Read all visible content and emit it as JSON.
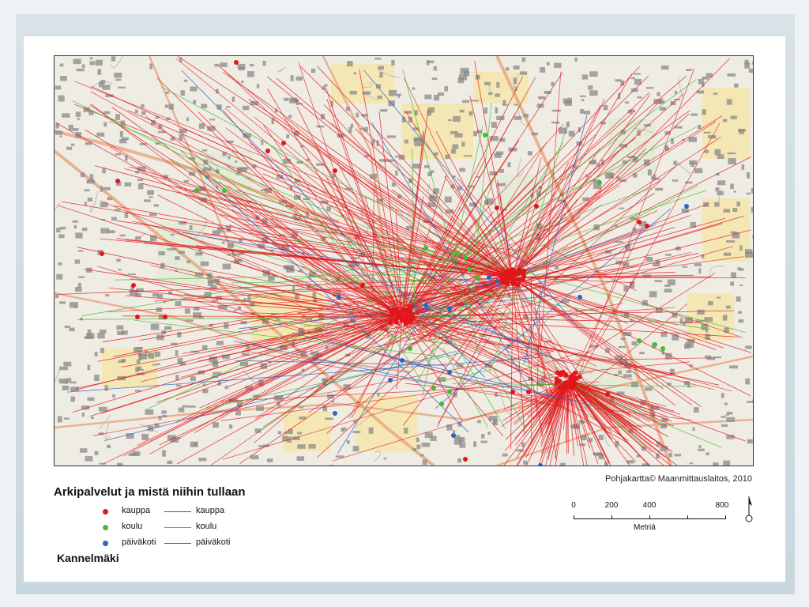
{
  "map": {
    "title": "Arkipalvelut ja mistä niihin tullaan",
    "place": "Kannelmäki",
    "credit": "Pohjakartta© Maanmittauslaitos, 2010",
    "colors": {
      "kauppa": "#e0161b",
      "koulu": "#3fbf2e",
      "paivakoti": "#2b63c6",
      "background": "#efece4",
      "road": "#e8a882",
      "building": "#8a8a8a",
      "field": "#f5e6a8"
    }
  },
  "legend": {
    "items": [
      {
        "point_label": "kauppa",
        "line_label": "kauppa",
        "color": "#e0161b"
      },
      {
        "point_label": "koulu",
        "line_label": "koulu",
        "color": "#3fbf2e"
      },
      {
        "point_label": "päiväkoti",
        "line_label": "päiväkoti",
        "color": "#2b63c6"
      }
    ]
  },
  "scale": {
    "labels": [
      "0",
      "200",
      "400",
      "800"
    ],
    "unit": "Metriä"
  }
}
